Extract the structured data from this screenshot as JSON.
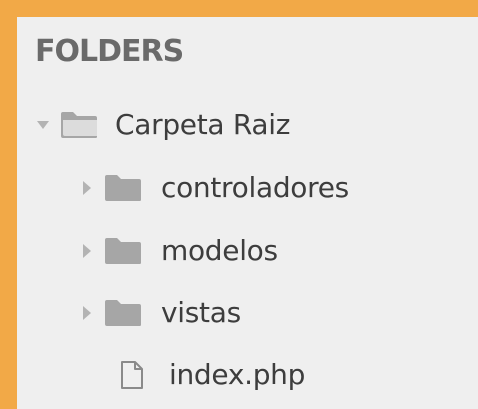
{
  "sidebar": {
    "section_title": "FOLDERS",
    "root": {
      "label": "Carpeta Raiz",
      "expanded": true,
      "icon": "folder-open-icon",
      "children": [
        {
          "label": "controladores",
          "type": "folder",
          "expanded": false,
          "icon": "folder-icon"
        },
        {
          "label": "modelos",
          "type": "folder",
          "expanded": false,
          "icon": "folder-icon"
        },
        {
          "label": "vistas",
          "type": "folder",
          "expanded": false,
          "icon": "folder-icon"
        },
        {
          "label": "index.php",
          "type": "file",
          "icon": "file-icon"
        }
      ]
    }
  },
  "colors": {
    "frame": "#F2A947",
    "panel": "#EFEFEF",
    "title": "#6A6A6A",
    "label": "#3D3D3D",
    "icon": "#A6A6A6",
    "arrow": "#B3B3B3"
  }
}
